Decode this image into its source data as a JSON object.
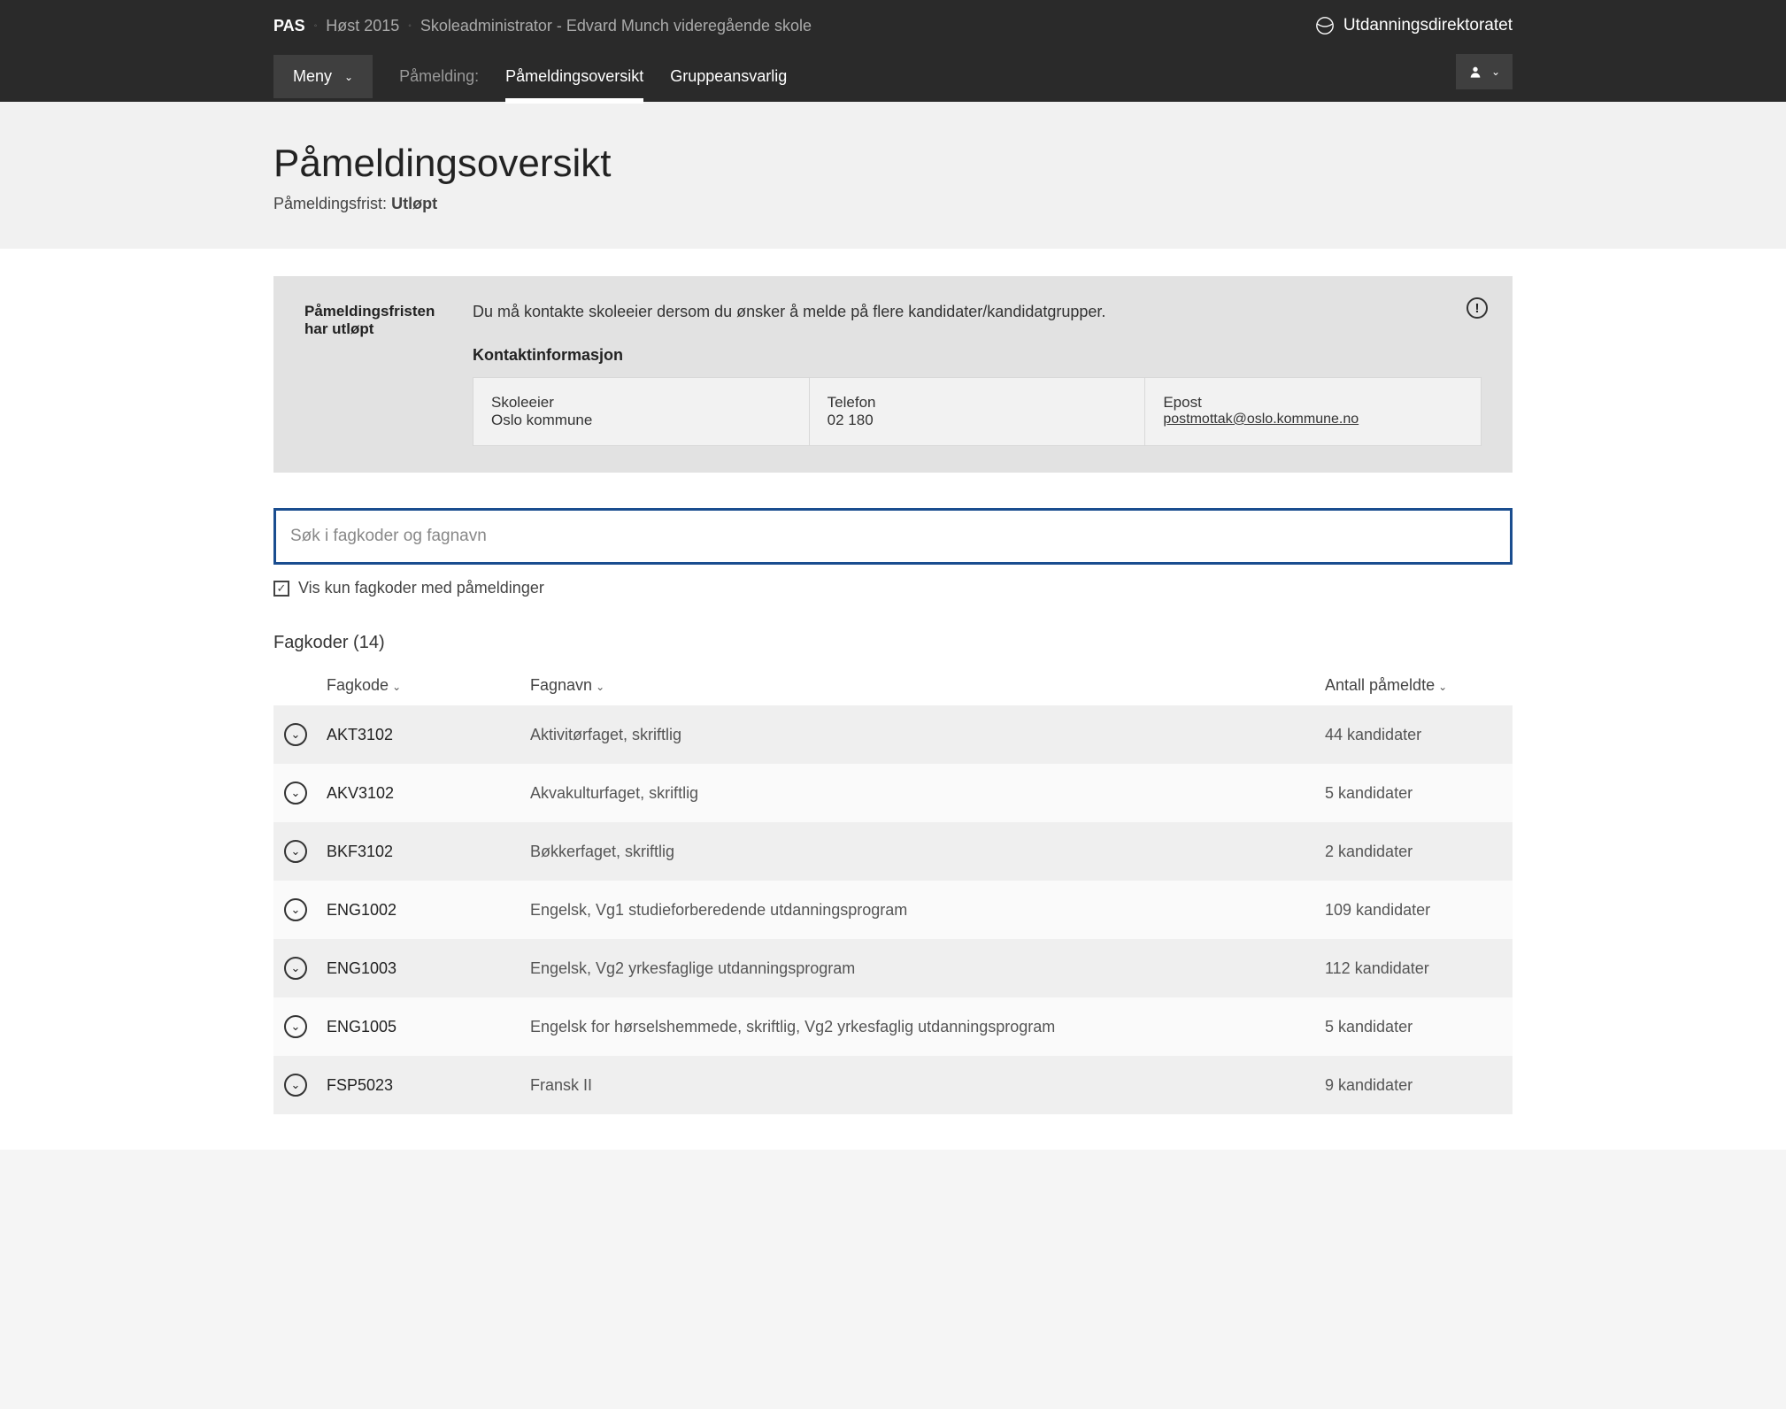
{
  "header": {
    "brand": "PAS",
    "crumbs": [
      "Høst 2015",
      "Skoleadministrator - Edvard Munch videregående skole"
    ],
    "org_name": "Utdanningsdirektoratet",
    "menu_label": "Meny",
    "nav_prefix": "Påmelding:",
    "nav_items": [
      {
        "label": "Påmeldingsoversikt",
        "active": true
      },
      {
        "label": "Gruppeansvarlig",
        "active": false
      }
    ]
  },
  "page": {
    "title": "Påmeldingsoversikt",
    "deadline_label": "Påmeldingsfrist:",
    "deadline_status": "Utløpt"
  },
  "notice": {
    "heading": "Påmeldingsfristen har utløpt",
    "message": "Du må kontakte skoleeier dersom du ønsker å melde på flere kandidater/kandidatgrupper.",
    "contact_heading": "Kontaktinformasjon",
    "contact": {
      "owner_label": "Skoleeier",
      "owner_value": "Oslo kommune",
      "phone_label": "Telefon",
      "phone_value": "02 180",
      "email_label": "Epost",
      "email_value": "postmottak@oslo.kommune.no"
    }
  },
  "search": {
    "placeholder": "Søk i fagkoder og fagnavn",
    "filter_label": "Vis kun fagkoder med påmeldinger",
    "filter_checked": true
  },
  "table": {
    "heading": "Fagkoder (14)",
    "columns": {
      "code": "Fagkode",
      "name": "Fagnavn",
      "count": "Antall påmeldte"
    },
    "rows": [
      {
        "code": "AKT3102",
        "name": "Aktivitørfaget, skriftlig",
        "count": "44 kandidater"
      },
      {
        "code": "AKV3102",
        "name": "Akvakulturfaget, skriftlig",
        "count": "5 kandidater"
      },
      {
        "code": "BKF3102",
        "name": "Bøkkerfaget, skriftlig",
        "count": "2 kandidater"
      },
      {
        "code": "ENG1002",
        "name": "Engelsk, Vg1 studieforberedende utdanningsprogram",
        "count": "109 kandidater"
      },
      {
        "code": "ENG1003",
        "name": "Engelsk, Vg2 yrkesfaglige utdanningsprogram",
        "count": "112 kandidater"
      },
      {
        "code": "ENG1005",
        "name": "Engelsk for hørselshemmede, skriftlig, Vg2 yrkesfaglig utdanningsprogram",
        "count": "5 kandidater"
      },
      {
        "code": "FSP5023",
        "name": "Fransk II",
        "count": "9 kandidater"
      }
    ]
  }
}
